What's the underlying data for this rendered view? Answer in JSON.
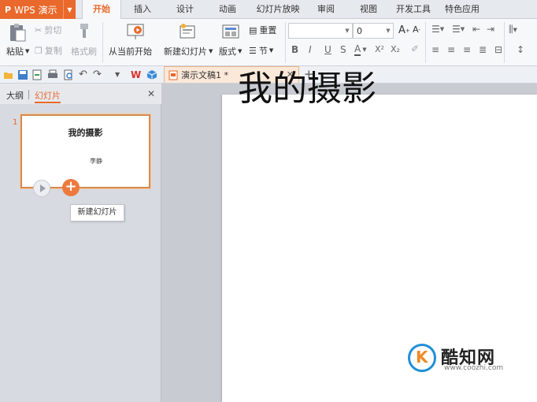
{
  "app": {
    "name": "WPS 演示",
    "logo": "P"
  },
  "menu_tabs": [
    "开始",
    "插入",
    "设计",
    "动画",
    "幻灯片放映",
    "审阅",
    "视图",
    "开发工具",
    "特色应用"
  ],
  "ribbon": {
    "cut": "剪切",
    "paste": "粘贴",
    "copy": "复制",
    "format_painter": "格式刷",
    "from_current": "从当前开始",
    "new_slide": "新建幻灯片",
    "layout": "版式",
    "reset": "重置",
    "section": "节",
    "font_size": "0",
    "bold": "B",
    "italic": "I",
    "underline": "U",
    "strike": "S",
    "font_color": "A",
    "superscript": "X²",
    "subscript": "X₂"
  },
  "document": {
    "tab_name": "演示文稿1 *"
  },
  "left_panel": {
    "tab_outline": "大纲",
    "tab_slides": "幻灯片",
    "slide_number": "1",
    "thumb_title": "我的摄影",
    "thumb_subtitle": "李静",
    "tooltip": "新建幻灯片"
  },
  "slide": {
    "title": "我的摄影"
  },
  "watermark": {
    "name": "酷知网",
    "url": "www.coozhi.com"
  },
  "colors": {
    "accent": "#e8692b",
    "tab_active": "#f7f8fa"
  }
}
